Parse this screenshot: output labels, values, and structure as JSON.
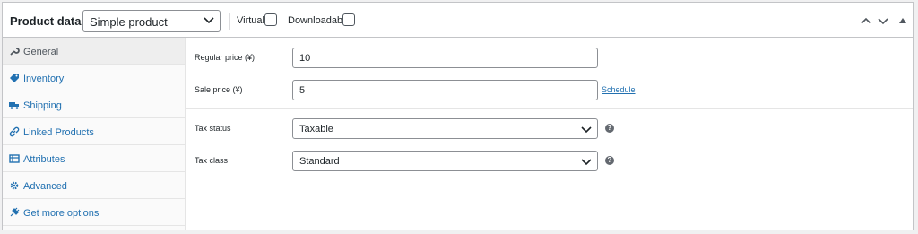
{
  "header": {
    "title": "Product data —",
    "product_type": "Simple product",
    "virtual_label": "Virtual:",
    "downloadable_label": "Downloadable:"
  },
  "tabs": [
    {
      "label": "General",
      "icon": "wrench-icon"
    },
    {
      "label": "Inventory",
      "icon": "tag-icon"
    },
    {
      "label": "Shipping",
      "icon": "truck-icon"
    },
    {
      "label": "Linked Products",
      "icon": "link-icon"
    },
    {
      "label": "Attributes",
      "icon": "table-icon"
    },
    {
      "label": "Advanced",
      "icon": "gear-icon"
    },
    {
      "label": "Get more options",
      "icon": "plugin-icon"
    }
  ],
  "fields": {
    "regular_price_label": "Regular price (¥)",
    "regular_price_value": "10",
    "sale_price_label": "Sale price (¥)",
    "sale_price_value": "5",
    "schedule_link": "Schedule",
    "tax_status_label": "Tax status",
    "tax_status_value": "Taxable",
    "tax_class_label": "Tax class",
    "tax_class_value": "Standard",
    "help_glyph": "?"
  },
  "colors": {
    "link": "#2271b1",
    "border": "#c3c4c7",
    "text": "#1d2327"
  }
}
